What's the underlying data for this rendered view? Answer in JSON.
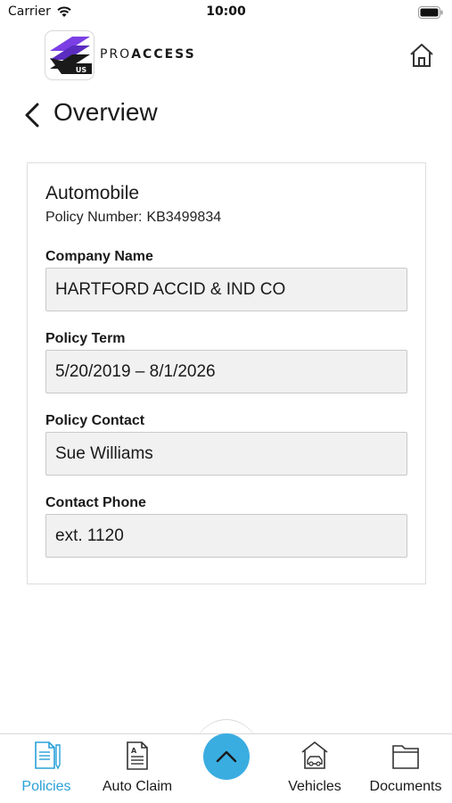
{
  "status_bar": {
    "carrier": "Carrier",
    "time": "10:00"
  },
  "header": {
    "logo_badge": "US",
    "brand_prefix": "PRO",
    "brand_suffix": "ACCESS",
    "home_icon": "home-icon"
  },
  "nav": {
    "title": "Overview",
    "back_icon": "chevron-left-icon"
  },
  "policy": {
    "type": "Automobile",
    "number_label": "Policy Number:",
    "number": "KB3499834",
    "fields": [
      {
        "label": "Company Name",
        "value": "HARTFORD ACCID & IND CO"
      },
      {
        "label": "Policy Term",
        "value": "5/20/2019 – 8/1/2026"
      },
      {
        "label": "Policy Contact",
        "value": "Sue Williams"
      },
      {
        "label": "Contact Phone",
        "value": "ext. 1120"
      }
    ]
  },
  "tab_bar": {
    "tabs": [
      {
        "label": "Policies",
        "icon": "policies-icon",
        "active": true
      },
      {
        "label": "Auto Claim",
        "icon": "auto-claim-icon",
        "active": false
      },
      {
        "label": "Vehicles",
        "icon": "vehicles-icon",
        "active": false
      },
      {
        "label": "Documents",
        "icon": "documents-icon",
        "active": false
      }
    ],
    "center_button_icon": "chevron-up-icon"
  },
  "colors": {
    "accent": "#3aade0",
    "active_tab": "#2aa0d8",
    "logo_purple": "#7b3fe4"
  }
}
